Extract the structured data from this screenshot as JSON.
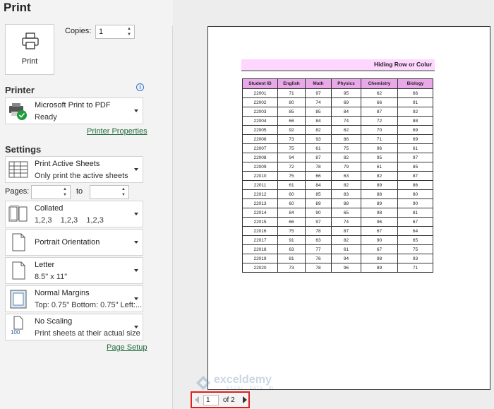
{
  "header": {
    "title": "Print"
  },
  "print_button": {
    "label": "Print"
  },
  "copies": {
    "label": "Copies:",
    "value": "1"
  },
  "printer": {
    "heading": "Printer",
    "name": "Microsoft Print to PDF",
    "status": "Ready",
    "properties_link": "Printer Properties"
  },
  "settings": {
    "heading": "Settings",
    "scope": {
      "title": "Print Active Sheets",
      "subtitle": "Only print the active sheets"
    },
    "pages": {
      "label": "Pages:",
      "from": "",
      "to_label": "to",
      "to": ""
    },
    "collation": {
      "title": "Collated",
      "subtitle": "1,2,3    1,2,3    1,2,3"
    },
    "orientation": {
      "title": "Portrait Orientation"
    },
    "paper": {
      "title": "Letter",
      "subtitle": "8.5\" x 11\""
    },
    "margins": {
      "title": "Normal Margins",
      "subtitle": "Top: 0.75\" Bottom: 0.75\" Left:..."
    },
    "scaling": {
      "title": "No Scaling",
      "subtitle": "Print sheets at their actual size",
      "icon_text": "100"
    },
    "page_setup_link": "Page Setup"
  },
  "preview": {
    "banner": "Hiding Row or Colur",
    "headers": [
      "Student ID",
      "English",
      "Math",
      "Physics",
      "Chemistry",
      "Biology"
    ],
    "rows": [
      [
        "22001",
        "71",
        "97",
        "95",
        "62",
        "66"
      ],
      [
        "22002",
        "80",
        "74",
        "69",
        "66",
        "91"
      ],
      [
        "22003",
        "85",
        "85",
        "84",
        "87",
        "92"
      ],
      [
        "22004",
        "66",
        "84",
        "74",
        "72",
        "88"
      ],
      [
        "22005",
        "92",
        "82",
        "62",
        "70",
        "69"
      ],
      [
        "22006",
        "73",
        "93",
        "86",
        "71",
        "69"
      ],
      [
        "22007",
        "75",
        "61",
        "75",
        "96",
        "61"
      ],
      [
        "22008",
        "94",
        "87",
        "82",
        "95",
        "97"
      ],
      [
        "22009",
        "72",
        "78",
        "79",
        "61",
        "85"
      ],
      [
        "22010",
        "75",
        "66",
        "63",
        "82",
        "87"
      ],
      [
        "22011",
        "61",
        "84",
        "82",
        "89",
        "86"
      ],
      [
        "22012",
        "60",
        "85",
        "83",
        "88",
        "80"
      ],
      [
        "22013",
        "60",
        "89",
        "88",
        "89",
        "90"
      ],
      [
        "22014",
        "84",
        "90",
        "65",
        "98",
        "81"
      ],
      [
        "22015",
        "66",
        "97",
        "74",
        "96",
        "67"
      ],
      [
        "22016",
        "75",
        "78",
        "87",
        "67",
        "64"
      ],
      [
        "22017",
        "91",
        "63",
        "82",
        "90",
        "65"
      ],
      [
        "22018",
        "63",
        "77",
        "61",
        "67",
        "75"
      ],
      [
        "22019",
        "81",
        "76",
        "94",
        "98",
        "93"
      ],
      [
        "22020",
        "73",
        "78",
        "96",
        "89",
        "71"
      ]
    ],
    "header_color": "#e9a9e9",
    "banner_color": "#ffd6ff"
  },
  "watermark": {
    "name": "exceldemy",
    "tagline": "EXCEL · DATA · BI"
  },
  "pager": {
    "current": "1",
    "of": "of 2"
  },
  "colors": {
    "accent_link": "#1e6b3a",
    "highlight_box": "#e01f1f"
  }
}
